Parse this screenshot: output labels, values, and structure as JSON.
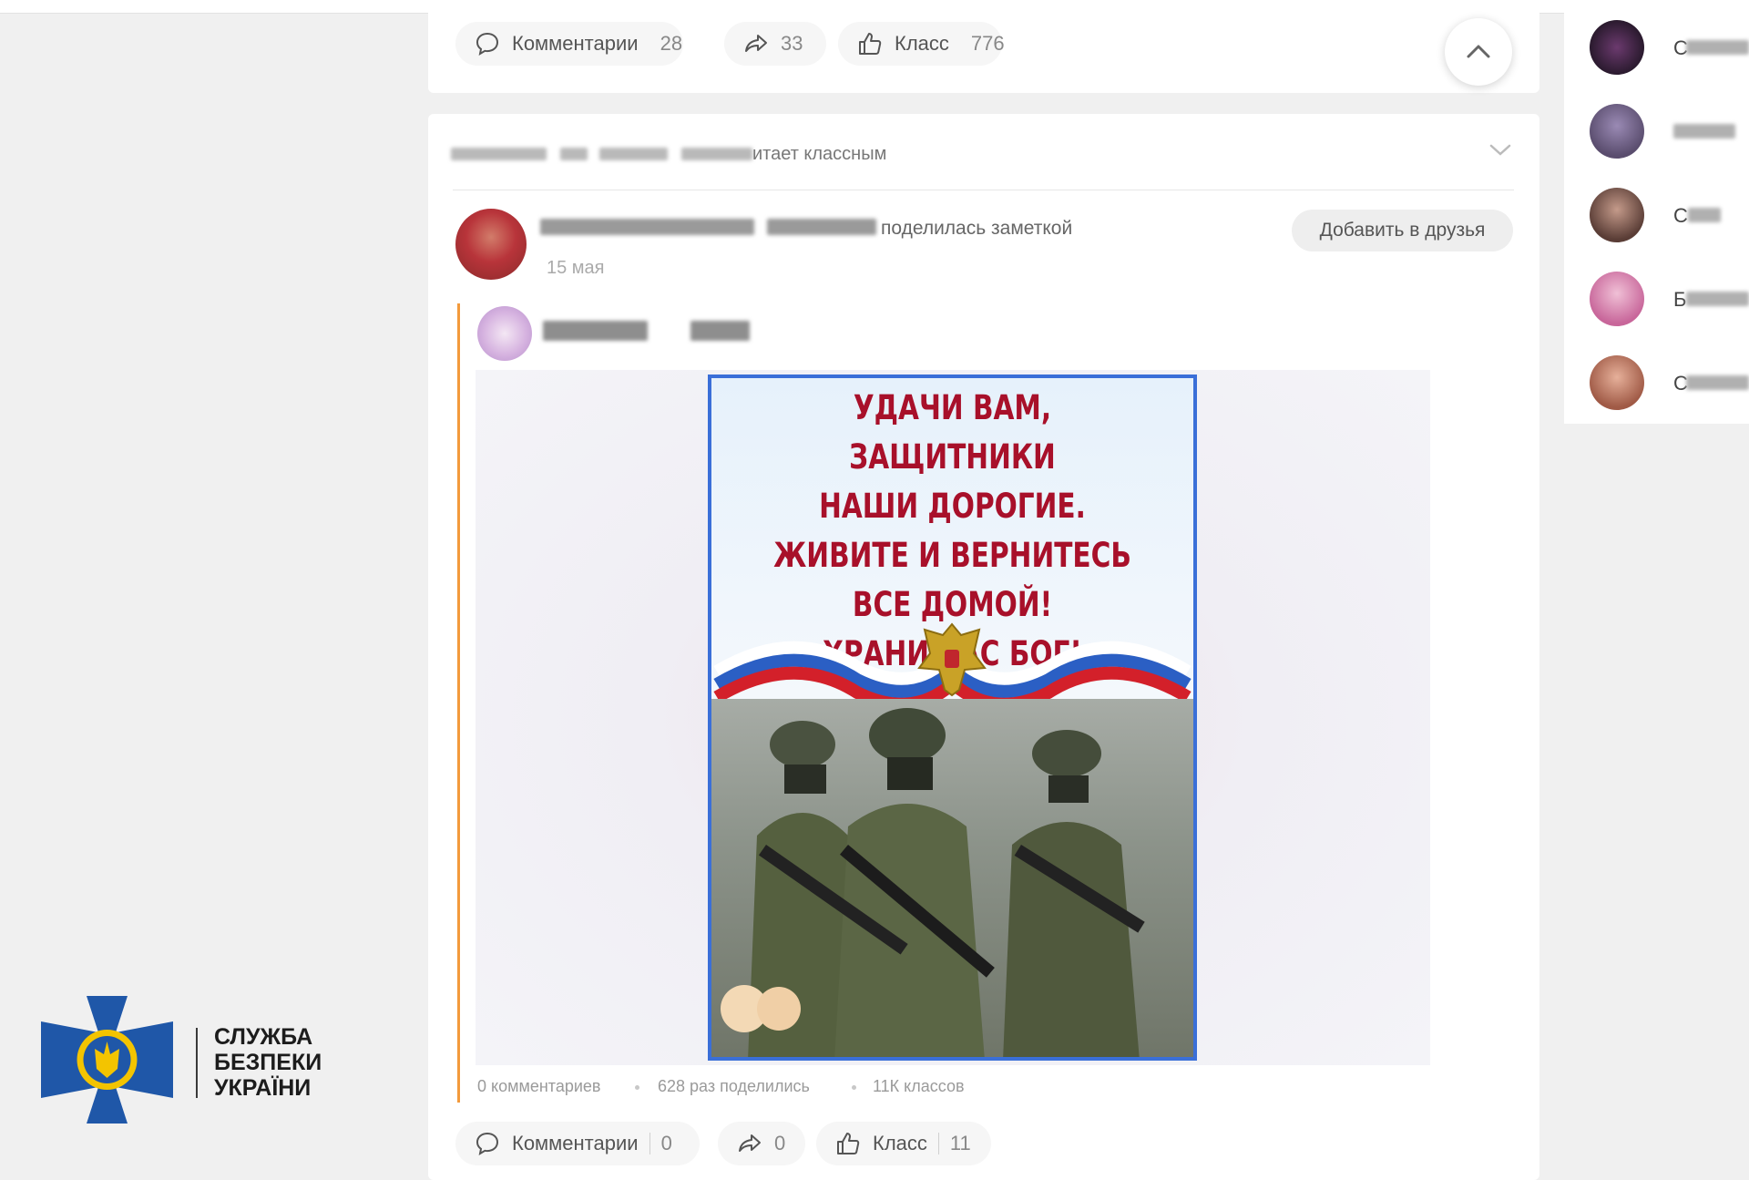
{
  "previous_post": {
    "comments_label": "Комментарии",
    "comments_count": "28",
    "shares_count": "33",
    "likes_label": "Класс",
    "likes_count": "776"
  },
  "feed_post": {
    "header_suffix": "итает классным",
    "author_action": "поделилась заметкой",
    "date": "15 мая",
    "add_friend_label": "Добавить в друзья",
    "poster_text": [
      "УДАЧИ ВАМ, ЗАЩИТНИКИ",
      "НАШИ ДОРОГИЕ.",
      "ЖИВИТЕ И ВЕРНИТЕСЬ",
      "ВСЕ ДОМОЙ!",
      "ХРАНИ ВАС БОГ!"
    ],
    "stats": {
      "comments": "0 комментариев",
      "shares": "628 раз поделились",
      "likes": "11К классов"
    },
    "actions": {
      "comments_label": "Комментарии",
      "comments_count": "0",
      "shares_count": "0",
      "likes_label": "Класс",
      "likes_count": "11"
    }
  },
  "sidebar": {
    "friends": [
      {
        "initial": "С"
      },
      {
        "initial": ""
      },
      {
        "initial": "С"
      },
      {
        "initial": "Б"
      },
      {
        "initial": "С"
      }
    ]
  },
  "watermark": {
    "lines": [
      "СЛУЖБА",
      "БЕЗПЕКИ",
      "УКРАЇНИ"
    ],
    "colors": {
      "blue": "#1f57a8",
      "yellow": "#f3c400"
    }
  },
  "colors": {
    "accent_orange": "#f39a3c",
    "poster_text": "#a8102a",
    "poster_border": "#3a6fd8"
  }
}
